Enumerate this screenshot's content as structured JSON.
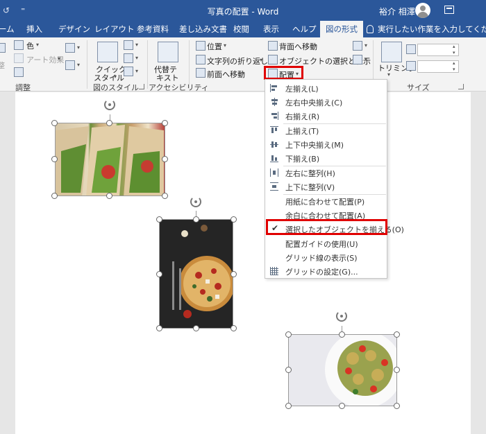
{
  "titlebar": {
    "title": "写真の配置  -  Word",
    "user": "裕介 相澤",
    "qa_undo": "↺",
    "qa_more": "⁼"
  },
  "tabs": [
    {
      "label": "ーム"
    },
    {
      "label": "挿入"
    },
    {
      "label": "デザイン"
    },
    {
      "label": "レイアウト"
    },
    {
      "label": "参考資料"
    },
    {
      "label": "差し込み文書"
    },
    {
      "label": "校閲"
    },
    {
      "label": "表示"
    },
    {
      "label": "ヘルプ"
    },
    {
      "label": "図の形式"
    }
  ],
  "tellme": "実行したい作業を入力してください",
  "ribbon": {
    "color": "色",
    "art_effect": "アート効果",
    "adjust_group": "調整",
    "quick_style_1": "クイック",
    "quick_style_2": "スタイル",
    "style_group": "図のスタイル",
    "alt_text_1": "代替テ",
    "alt_text_2": "キスト",
    "access_group": "アクセシビリティ",
    "position": "位置",
    "wrap_text": "文字列の折り返し",
    "bring_forward": "前面へ移動",
    "send_backward": "背面へ移動",
    "selection_pane": "オブジェクトの選択と表示",
    "align": "配置",
    "crop": "トリミング",
    "size_group": "サイズ",
    "partial_char": "整"
  },
  "menu": {
    "items": [
      {
        "label": "左揃え(L)"
      },
      {
        "label": "左右中央揃え(C)"
      },
      {
        "label": "右揃え(R)"
      },
      {
        "label": "上揃え(T)"
      },
      {
        "label": "上下中央揃え(M)"
      },
      {
        "label": "下揃え(B)"
      },
      {
        "label": "左右に整列(H)"
      },
      {
        "label": "上下に整列(V)"
      },
      {
        "label": "用紙に合わせて配置(P)"
      },
      {
        "label": "余白に合わせて配置(A)"
      },
      {
        "label": "選択したオブジェクトを揃える(O)",
        "checked": true
      },
      {
        "label": "配置ガイドの使用(U)"
      },
      {
        "label": "グリッド線の表示(S)"
      },
      {
        "label": "グリッドの設定(G)..."
      }
    ],
    "check_mark": "✔"
  },
  "colors": {
    "accent": "#2b579a",
    "highlight": "#e00000"
  }
}
